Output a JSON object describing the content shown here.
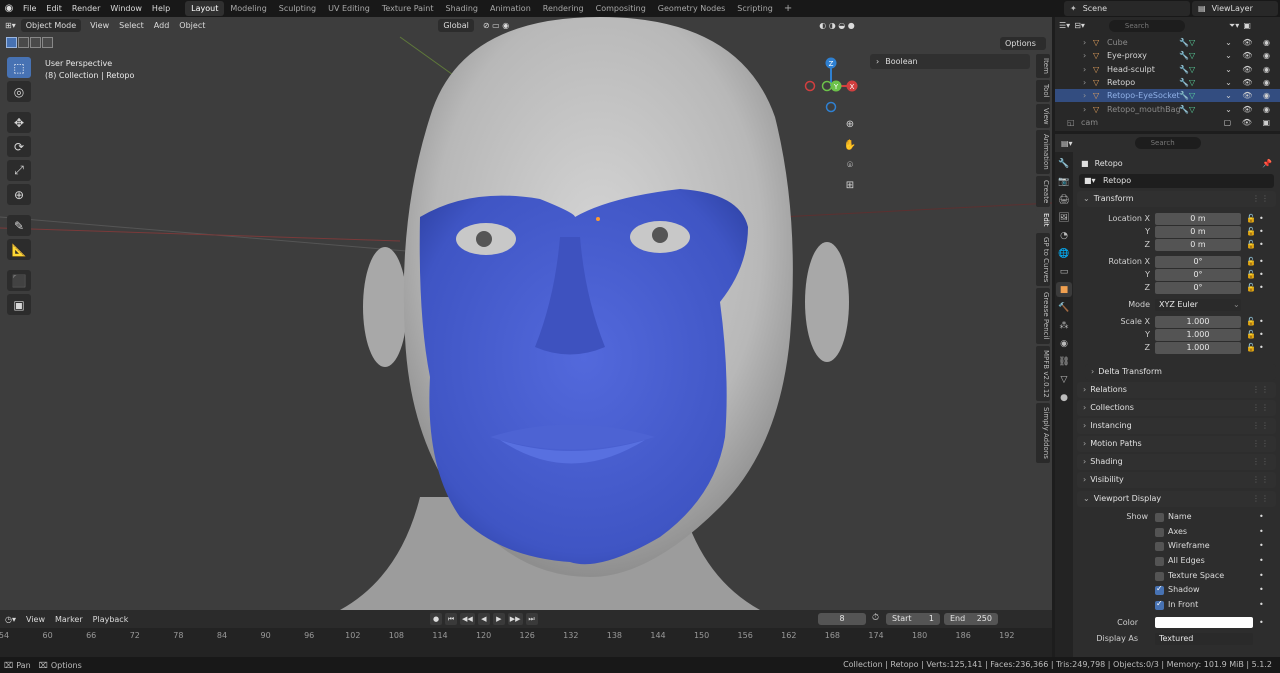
{
  "topbar": {
    "menus": [
      "File",
      "Edit",
      "Render",
      "Window",
      "Help"
    ],
    "workspaces": [
      "Layout",
      "Modeling",
      "Sculpting",
      "UV Editing",
      "Texture Paint",
      "Shading",
      "Animation",
      "Rendering",
      "Compositing",
      "Geometry Nodes",
      "Scripting"
    ],
    "active_workspace": "Layout",
    "add_tab": "+",
    "scene": "Scene",
    "view_layer": "ViewLayer"
  },
  "viewport": {
    "mode": "Object Mode",
    "menus": [
      "View",
      "Select",
      "Add",
      "Object"
    ],
    "transform_orientation": "Global",
    "options_label": "Options",
    "info_line1": "User Perspective",
    "info_line2": "(8) Collection | Retopo",
    "boolean_panel": "Boolean",
    "side_tabs": [
      "Item",
      "Tool",
      "View",
      "Animation",
      "Create",
      "Edit",
      "GP to Curves",
      "Grease Pencil",
      "MPFB v2.0.12",
      "Simply Addons"
    ],
    "gizmo": {
      "z": "Z",
      "x": "X",
      "y": "Y"
    }
  },
  "outliner": {
    "search_placeholder": "Search",
    "rows": [
      {
        "name": "Cube",
        "state": "dim"
      },
      {
        "name": "Eye-proxy",
        "state": "normal"
      },
      {
        "name": "Head-sculpt",
        "state": "normal"
      },
      {
        "name": "Retopo",
        "state": "normal"
      },
      {
        "name": "Retopo-EyeSocket",
        "state": "selected"
      },
      {
        "name": "Retopo_mouthBag",
        "state": "dim"
      },
      {
        "name": "cam",
        "state": "dim"
      }
    ]
  },
  "properties": {
    "search_placeholder": "Search",
    "object_name": "Retopo",
    "object_field": "Retopo",
    "transform": {
      "title": "Transform",
      "location_label": "Location X",
      "location": [
        "0 m",
        "0 m",
        "0 m"
      ],
      "rotation_label": "Rotation X",
      "rotation": [
        "0°",
        "0°",
        "0°"
      ],
      "y_label": "Y",
      "z_label": "Z",
      "mode_label": "Mode",
      "mode_value": "XYZ Euler",
      "scale_label": "Scale X",
      "scale": [
        "1.000",
        "1.000",
        "1.000"
      ],
      "delta": "Delta Transform"
    },
    "panels": [
      "Relations",
      "Collections",
      "Instancing",
      "Motion Paths",
      "Shading",
      "Visibility"
    ],
    "viewport_display": {
      "title": "Viewport Display",
      "show_label": "Show",
      "options": [
        {
          "label": "Name",
          "checked": false
        },
        {
          "label": "Axes",
          "checked": false
        },
        {
          "label": "Wireframe",
          "checked": false
        },
        {
          "label": "All Edges",
          "checked": false
        },
        {
          "label": "Texture Space",
          "checked": false
        },
        {
          "label": "Shadow",
          "checked": true
        },
        {
          "label": "In Front",
          "checked": true
        }
      ],
      "color_label": "Color",
      "display_as_label": "Display As",
      "display_as": "Textured"
    }
  },
  "timeline": {
    "menus": [
      "View",
      "Marker",
      "Playback"
    ],
    "current_frame": "8",
    "start_label": "Start",
    "start": "1",
    "end_label": "End",
    "end": "250",
    "ticks": [
      "54",
      "60",
      "66",
      "72",
      "78",
      "84",
      "90",
      "96",
      "102",
      "108",
      "114",
      "120",
      "126",
      "132",
      "138",
      "144",
      "150",
      "156",
      "162",
      "168",
      "174",
      "180",
      "186",
      "192"
    ]
  },
  "statusbar": {
    "left1": "Pan",
    "left2": "Options",
    "right": "Collection | Retopo | Verts:125,141 | Faces:236,366 | Tris:249,798 | Objects:0/3 | Memory: 101.9 MiB | 5.1.2"
  },
  "colors": {
    "accent": "#4772b3",
    "mesh_blue": "#3f55c4",
    "object_orange": "#e5a25d"
  }
}
